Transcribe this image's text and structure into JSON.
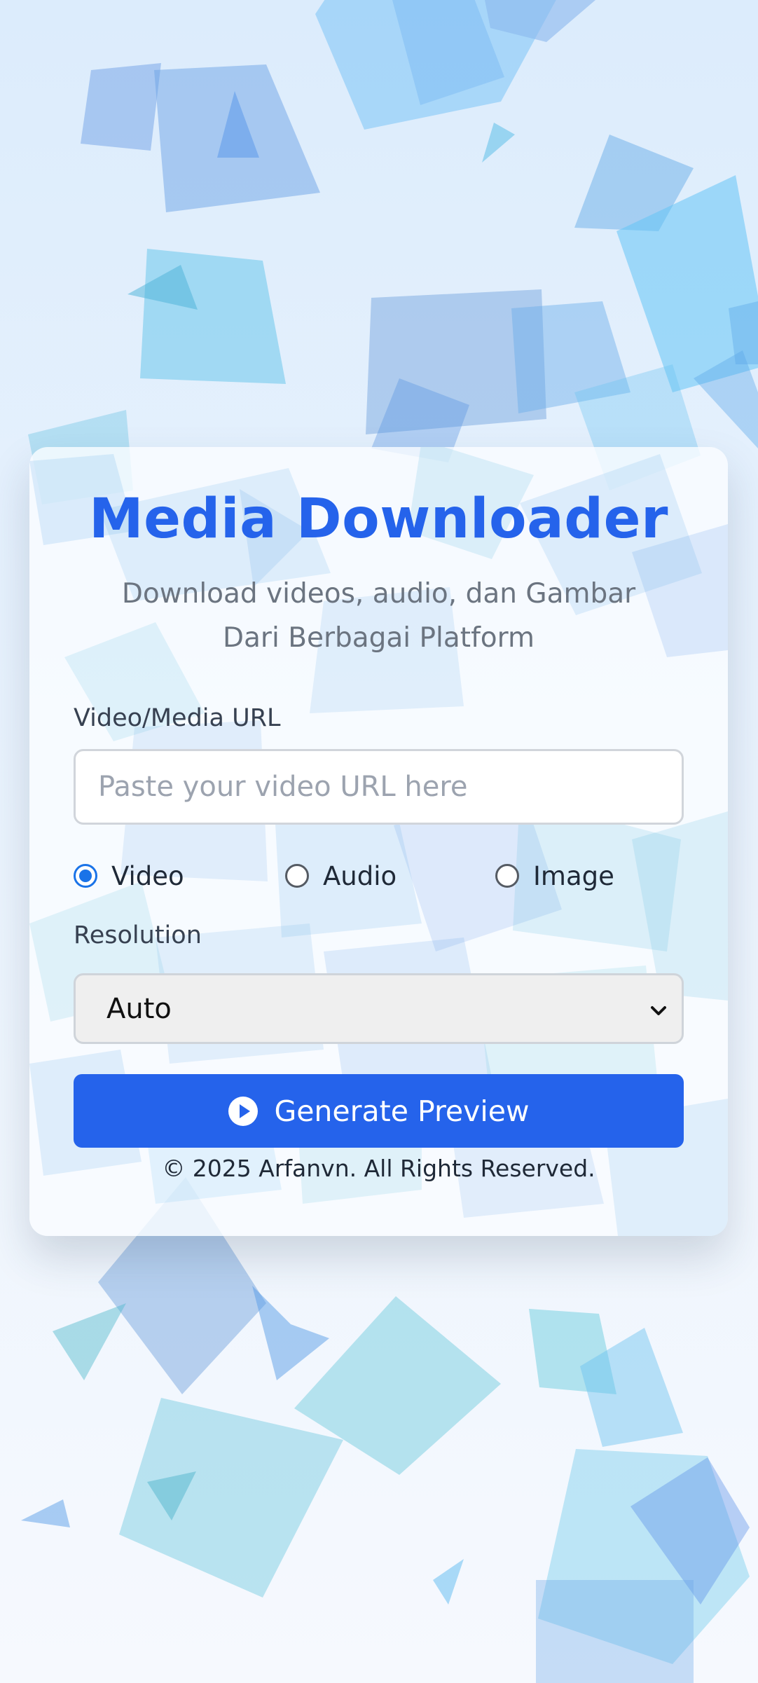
{
  "app": {
    "title": "Media Downloader",
    "subtitle": "Download videos, audio, dan Gambar Dari Berbagai Platform"
  },
  "form": {
    "url_label": "Video/Media URL",
    "url_placeholder": "Paste your video URL here",
    "url_value": "",
    "media_types": [
      {
        "label": "Video",
        "checked": true
      },
      {
        "label": "Audio",
        "checked": false
      },
      {
        "label": "Image",
        "checked": false
      }
    ],
    "resolution_label": "Resolution",
    "resolution_value": "Auto",
    "submit_label": "Generate Preview",
    "submit_icon": "play-circle-icon"
  },
  "footer": {
    "copyright": "© 2025 Arfanvn. All Rights Reserved."
  },
  "colors": {
    "accent": "#2563eb",
    "radio_checked": "#1a73e8",
    "subtitle": "#6b7480",
    "label": "#374151"
  }
}
